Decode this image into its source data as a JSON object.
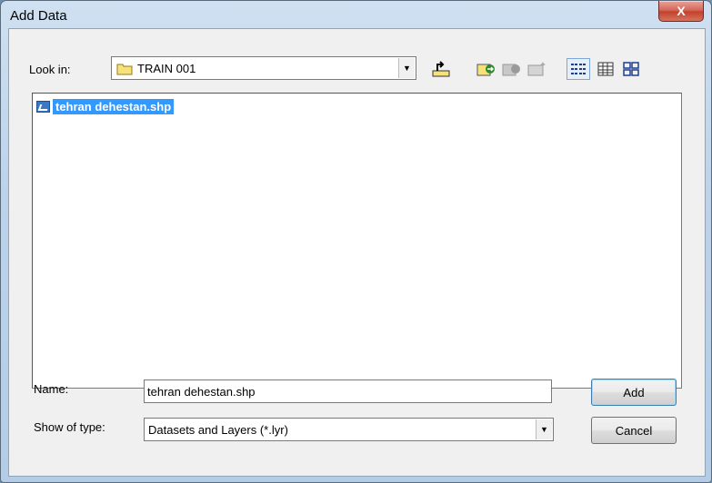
{
  "window": {
    "title": "Add Data",
    "close_symbol": "X"
  },
  "toolbar": {
    "look_in_label": "Look in:",
    "look_in_value": "TRAIN 001",
    "buttons": [
      "up-one-level",
      "connect-to-folder",
      "disconnect-folder",
      "new-folder",
      "list-view",
      "details-view",
      "thumbnails-view"
    ]
  },
  "files": [
    {
      "name": "tehran dehestan.shp",
      "selected": true,
      "icon": "shapefile-icon"
    }
  ],
  "form": {
    "name_label": "Name:",
    "name_value": "tehran dehestan.shp",
    "type_label": "Show of type:",
    "type_value": "Datasets and Layers (*.lyr)",
    "add_label": "Add",
    "cancel_label": "Cancel"
  },
  "colors": {
    "selection": "#3399ff",
    "close_button": "#c5412f"
  }
}
